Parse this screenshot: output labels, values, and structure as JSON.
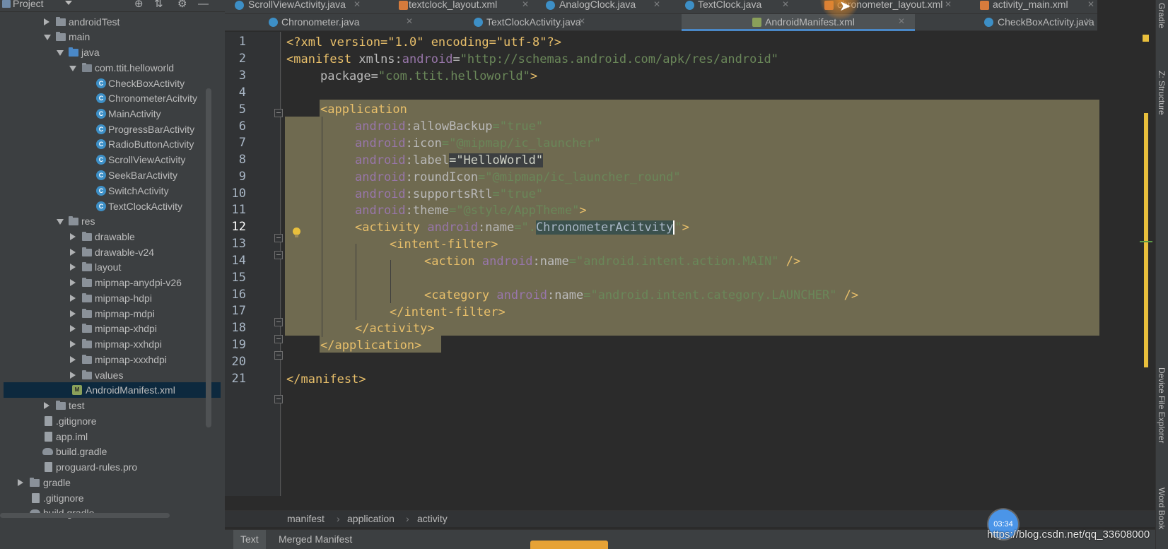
{
  "project_panel": {
    "title": "Project",
    "tree": [
      {
        "label": "androidTest",
        "type": "folder"
      },
      {
        "label": "main",
        "type": "folder"
      },
      {
        "label": "java",
        "type": "folder-blue"
      },
      {
        "label": "com.ttit.helloworld",
        "type": "package"
      },
      {
        "label": "CheckBoxActivity",
        "type": "class"
      },
      {
        "label": "ChronometerAcitvity",
        "type": "class"
      },
      {
        "label": "MainActivity",
        "type": "class"
      },
      {
        "label": "ProgressBarActivity",
        "type": "class"
      },
      {
        "label": "RadioButtonActivity",
        "type": "class"
      },
      {
        "label": "ScrollViewActivity",
        "type": "class"
      },
      {
        "label": "SeekBarActivity",
        "type": "class"
      },
      {
        "label": "SwitchActivity",
        "type": "class"
      },
      {
        "label": "TextClockActivity",
        "type": "class"
      },
      {
        "label": "res",
        "type": "folder"
      },
      {
        "label": "drawable",
        "type": "folder"
      },
      {
        "label": "drawable-v24",
        "type": "folder"
      },
      {
        "label": "layout",
        "type": "folder"
      },
      {
        "label": "mipmap-anydpi-v26",
        "type": "folder"
      },
      {
        "label": "mipmap-hdpi",
        "type": "folder"
      },
      {
        "label": "mipmap-mdpi",
        "type": "folder"
      },
      {
        "label": "mipmap-xhdpi",
        "type": "folder"
      },
      {
        "label": "mipmap-xxhdpi",
        "type": "folder"
      },
      {
        "label": "mipmap-xxxhdpi",
        "type": "folder"
      },
      {
        "label": "values",
        "type": "folder"
      },
      {
        "label": "AndroidManifest.xml",
        "type": "xml",
        "selected": true
      },
      {
        "label": "test",
        "type": "folder"
      },
      {
        "label": ".gitignore",
        "type": "file"
      },
      {
        "label": "app.iml",
        "type": "file"
      },
      {
        "label": "build.gradle",
        "type": "gradle"
      },
      {
        "label": "proguard-rules.pro",
        "type": "file"
      },
      {
        "label": "gradle",
        "type": "folder"
      },
      {
        "label": ".gitignore",
        "type": "file"
      },
      {
        "label": "build.gradle",
        "type": "gradle"
      }
    ]
  },
  "tabs_row1": [
    {
      "label": "ScrollViewActivity.java",
      "icon": "class-icon"
    },
    {
      "label": "textclock_layout.xml",
      "icon": "xml-layout-icon"
    },
    {
      "label": "AnalogClock.java",
      "icon": "class-icon"
    },
    {
      "label": "TextClock.java",
      "icon": "class-icon"
    },
    {
      "label": "chronometer_layout.xml",
      "icon": "xml-layout-icon"
    },
    {
      "label": "activity_main.xml",
      "icon": "xml-layout-icon"
    }
  ],
  "tabs_row2": [
    {
      "label": "Chronometer.java",
      "icon": "class-icon"
    },
    {
      "label": "TextClockActivity.java",
      "icon": "class-icon"
    },
    {
      "label": "AndroidManifest.xml",
      "icon": "manifest-icon",
      "active": true
    },
    {
      "label": "CheckBoxActivity.java",
      "icon": "class-icon"
    }
  ],
  "editor": {
    "line_numbers": [
      "1",
      "2",
      "3",
      "4",
      "5",
      "6",
      "7",
      "8",
      "9",
      "10",
      "11",
      "12",
      "13",
      "14",
      "15",
      "16",
      "17",
      "18",
      "19",
      "20",
      "21"
    ],
    "code": {
      "l1": "<?xml version=\"1.0\" encoding=\"utf-8\"?>",
      "l2_tag": "<manifest ",
      "l2_attr": "xmlns:",
      "l2_ns": "android",
      "l2_eq": "=",
      "l2_val": "\"http://schemas.android.com/apk/res/android\"",
      "l3_attr": "package",
      "l3_eq": "=",
      "l3_val": "\"com.ttit.helloworld\"",
      "l3_end": ">",
      "l5": "<application",
      "l6_ns": "android",
      "l6_attr": ":allowBackup",
      "l6_val": "=\"true\"",
      "l7_ns": "android",
      "l7_attr": ":icon",
      "l7_val": "=\"@mipmap/ic_launcher\"",
      "l8_ns": "android",
      "l8_attr": ":label",
      "l8_val": "=\"HelloWorld\"",
      "l9_ns": "android",
      "l9_attr": ":roundIcon",
      "l9_val": "=\"@mipmap/ic_launcher_round\"",
      "l10_ns": "android",
      "l10_attr": ":supportsRtl",
      "l10_val": "=\"true\"",
      "l11_ns": "android",
      "l11_attr": ":theme",
      "l11_val": "=\"@style/AppTheme\"",
      "l11_end": ">",
      "l12_tag": "<activity ",
      "l12_ns": "android",
      "l12_attr": ":name",
      "l12_val_a": "=\"",
      "l12_val_b": ".",
      "l12_val_c": "ChronometerAcitvity",
      "l12_val_d": "\"",
      "l12_end": ">",
      "l13": "<intent-filter>",
      "l14_tag": "<action ",
      "l14_ns": "android",
      "l14_attr": ":name",
      "l14_val": "=\"android.intent.action.MAIN\"",
      "l14_end": " />",
      "l16_tag": "<category ",
      "l16_ns": "android",
      "l16_attr": ":name",
      "l16_val": "=\"android.intent.category.LAUNCHER\"",
      "l16_end": " />",
      "l17": "</intent-filter>",
      "l18": "</activity>",
      "l19": "</application>",
      "l21": "</manifest>"
    }
  },
  "breadcrumb": [
    "manifest",
    "application",
    "activity"
  ],
  "bottom_tabs": [
    "Text",
    "Merged Manifest"
  ],
  "right_strip": [
    "Gradle",
    "Z: Structure",
    "Device File Explorer",
    "Word Book"
  ],
  "overlay": {
    "timer": "03:34",
    "watermark": "https://blog.csdn.net/qq_33608000"
  },
  "colors": {
    "background": "#2b2b2b",
    "panel": "#3c3f41",
    "selection": "#6f6a50",
    "tag": "#e8bf6a",
    "namespace": "#9876aa",
    "value": "#6a8759",
    "accent": "#4a88c7"
  }
}
